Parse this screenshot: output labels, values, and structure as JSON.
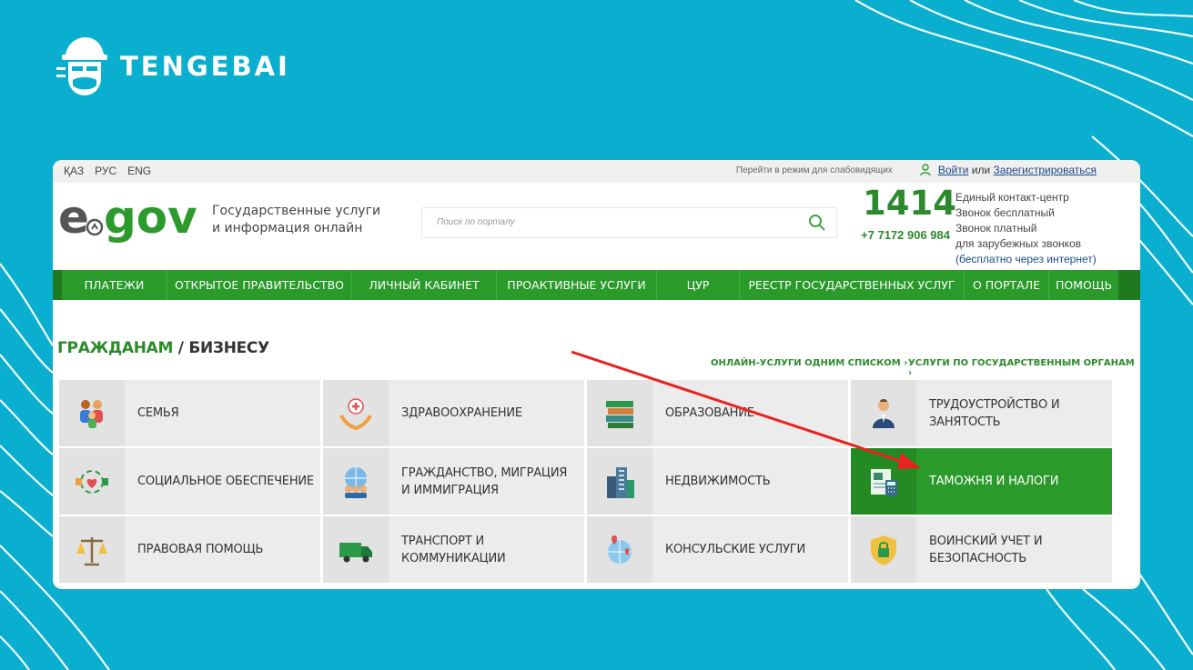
{
  "brand": {
    "name": "TENGEBAI"
  },
  "topbar": {
    "languages": [
      "ҚАЗ",
      "РУС",
      "ENG"
    ],
    "low_vision": "Перейти в режим для слабовидящих",
    "login": "Войти",
    "or": "или",
    "register": "Зарегистрироваться"
  },
  "header": {
    "tagline_line1": "Государственные услуги",
    "tagline_line2": "и информация онлайн",
    "search_placeholder": "Поиск по порталу",
    "phone_short": "1414",
    "phone_long": "+7 7172 906 984",
    "contact_lines": [
      "Единый контакт-центр",
      "Звонок бесплатный",
      "Звонок платный",
      "для зарубежных звонков",
      "(бесплатно через интернет)"
    ]
  },
  "nav": {
    "items": [
      "ПЛАТЕЖИ",
      "ОТКРЫТОЕ ПРАВИТЕЛЬСТВО",
      "ЛИЧНЫЙ КАБИНЕТ",
      "ПРОАКТИВНЫЕ УСЛУГИ",
      "ЦУР",
      "РЕЕСТР ГОСУДАРСТВЕННЫХ УСЛУГ",
      "О ПОРТАЛЕ",
      "ПОМОЩЬ"
    ]
  },
  "section": {
    "title_citizens": "ГРАЖДАНАМ",
    "title_sep": " / ",
    "title_business": "БИЗНЕСУ",
    "link_list": "ОНЛАЙН-УСЛУГИ ОДНИМ СПИСКОМ ›",
    "link_agencies": "УСЛУГИ ПО ГОСУДАРСТВЕННЫМ ОРГАНАМ ›"
  },
  "categories": [
    {
      "label": "СЕМЬЯ",
      "icon": "family-icon"
    },
    {
      "label": "ЗДРАВООХРАНЕНИЕ",
      "icon": "healthcare-icon"
    },
    {
      "label": "ОБРАЗОВАНИЕ",
      "icon": "books-icon"
    },
    {
      "label": "ТРУДОУСТРОЙСТВО И ЗАНЯТОСТЬ",
      "icon": "worker-icon"
    },
    {
      "label": "СОЦИАЛЬНОЕ ОБЕСПЕЧЕНИЕ",
      "icon": "social-heart-icon"
    },
    {
      "label": "ГРАЖДАНСТВО, МИГРАЦИЯ И ИММИГРАЦИЯ",
      "icon": "globe-people-icon"
    },
    {
      "label": "НЕДВИЖИМОСТЬ",
      "icon": "buildings-icon"
    },
    {
      "label": "ТАМОЖНЯ И НАЛОГИ",
      "icon": "customs-calculator-icon",
      "active": true
    },
    {
      "label": "ПРАВОВАЯ ПОМОЩЬ",
      "icon": "scales-icon"
    },
    {
      "label": "ТРАНСПОРТ И КОММУНИКАЦИИ",
      "icon": "truck-icon"
    },
    {
      "label": "КОНСУЛЬСКИЕ УСЛУГИ",
      "icon": "globe-pin-icon"
    },
    {
      "label": "ВОИНСКИЙ УЧЕТ И БЕЗОПАСНОСТЬ",
      "icon": "shield-lock-icon"
    }
  ],
  "colors": {
    "background": "#0aafcf",
    "green": "#2a9a2a",
    "annotation_arrow": "#e8231e"
  }
}
